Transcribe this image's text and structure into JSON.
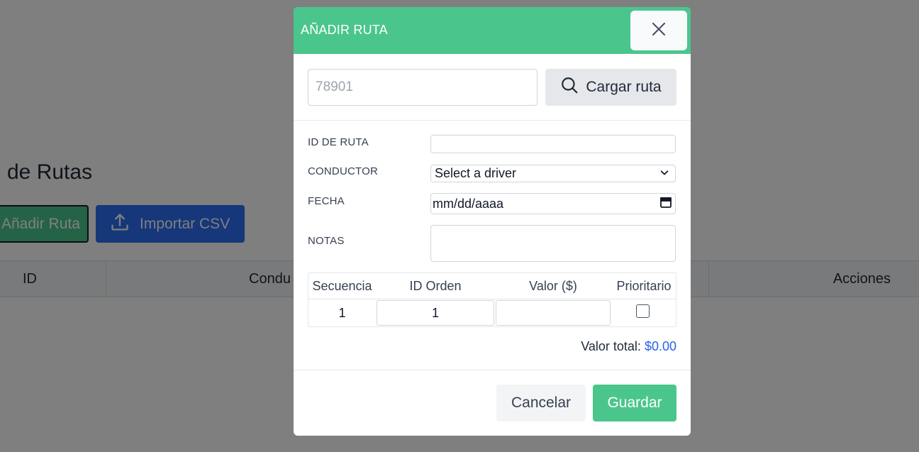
{
  "background": {
    "page_title": "de Rutas",
    "add_route_label": "Añadir Ruta",
    "import_csv_label": "Importar CSV",
    "table_headers": {
      "id": "ID",
      "driver": "Condu",
      "actions": "Acciones"
    }
  },
  "modal": {
    "title": "AÑADIR RUTA",
    "search": {
      "placeholder": "78901",
      "button_label": "Cargar ruta"
    },
    "fields": {
      "route_id_label": "ID DE RUTA",
      "driver_label": "CONDUCTOR",
      "driver_selected": "Select a driver",
      "date_label": "FECHA",
      "date_placeholder": "mm/dd/aaaa",
      "notes_label": "NOTAS"
    },
    "stops_table": {
      "headers": [
        "Secuencia",
        "ID Orden",
        "Valor ($)",
        "Prioritario"
      ],
      "rows": [
        {
          "sequence": "1",
          "order_id": "1",
          "value": "",
          "priority": false
        }
      ]
    },
    "total_label": "Valor total:",
    "total_value": "$0.00",
    "cancel_label": "Cancelar",
    "save_label": "Guardar"
  },
  "colors": {
    "accent_green": "#4ac68c",
    "import_blue": "#2c6ef2",
    "total_blue": "#2563eb"
  }
}
